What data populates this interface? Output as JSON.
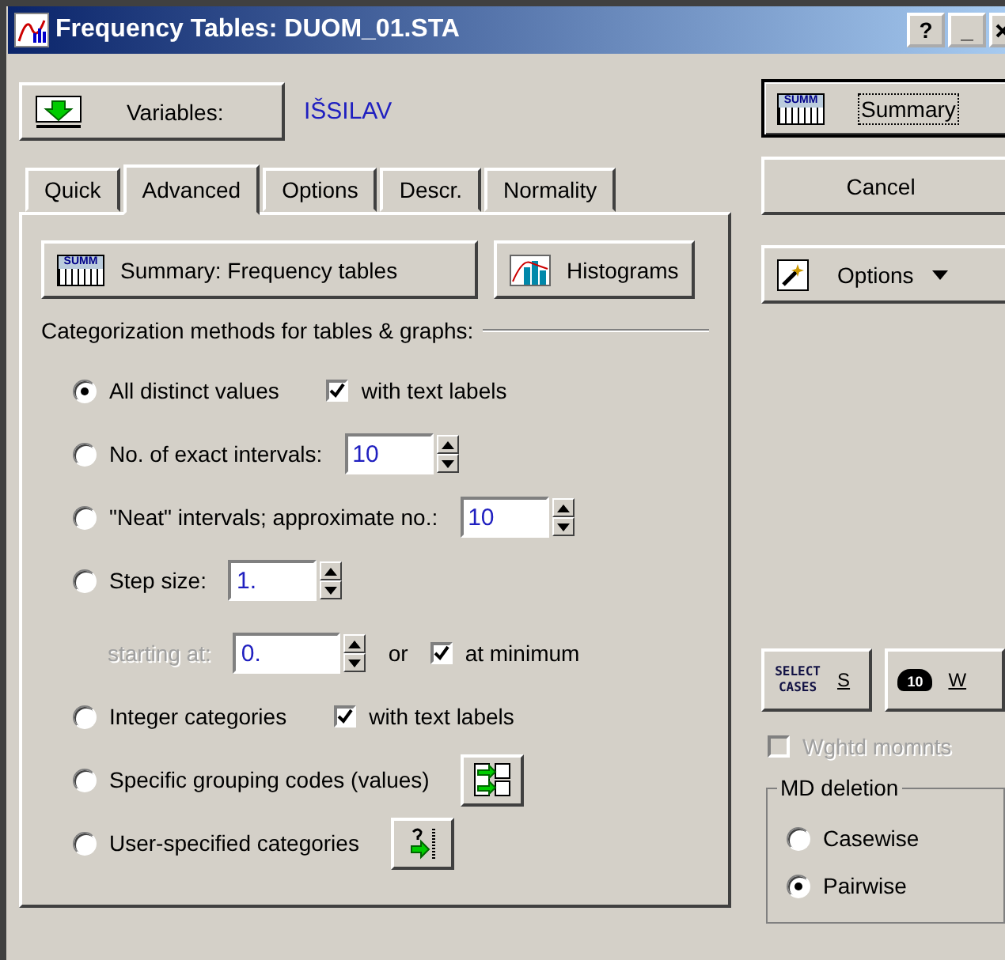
{
  "window": {
    "title": "Frequency Tables: DUOM_01.STA",
    "title_buttons": [
      "?",
      "_"
    ]
  },
  "variables": {
    "button": "Variables:",
    "value": "IŠSILAV"
  },
  "tabs": [
    {
      "label": "Quick",
      "selected": false
    },
    {
      "label": "Advanced",
      "selected": true
    },
    {
      "label": "Options",
      "selected": false
    },
    {
      "label": "Descr.",
      "selected": false
    },
    {
      "label": "Normality",
      "selected": false
    }
  ],
  "panel_buttons": [
    {
      "kind": "summary",
      "icon_text": "SUMM",
      "label": "Summary:  Frequency tables"
    },
    {
      "kind": "histogram",
      "label": "Histograms"
    }
  ],
  "section_heading": "Categorization methods for tables & graphs:",
  "methods": [
    {
      "kind": "checkbox",
      "label": "All distinct values",
      "selected": true,
      "check": {
        "label": "with text labels",
        "checked": true
      }
    },
    {
      "kind": "spin",
      "label": "No. of exact intervals:",
      "selected": false,
      "value": "10"
    },
    {
      "kind": "spin",
      "label": "\"Neat\" intervals; approximate no.:",
      "selected": false,
      "value": "10"
    },
    {
      "kind": "spin",
      "label": "Step size:",
      "selected": false,
      "value": "1."
    },
    {
      "kind": "start",
      "label": "starting at:",
      "disabled": true,
      "value": "0.",
      "joiner": "or",
      "check": {
        "label": "at minimum",
        "checked": true
      }
    },
    {
      "kind": "checkbox",
      "label": "Integer categories",
      "selected": false,
      "check": {
        "label": "with text labels",
        "checked": true
      }
    },
    {
      "kind": "codes",
      "label": "Specific grouping codes (values)",
      "selected": false
    },
    {
      "kind": "custom",
      "label": "User-specified categories",
      "selected": false
    }
  ],
  "side": {
    "summary": {
      "icon_text": "SUMM",
      "label": "Summary"
    },
    "cancel": "Cancel",
    "options": "Options",
    "select_cases": {
      "icon_text": "SELECT CASES",
      "shortcut": "S"
    },
    "weight": {
      "icon_text": "10",
      "shortcut": "W"
    },
    "weighted_moments": {
      "label": "Wghtd momnts",
      "checked": false,
      "disabled": true
    },
    "md_deletion": {
      "title": "MD deletion",
      "options": [
        {
          "label": "Casewise",
          "selected": false
        },
        {
          "label": "Pairwise",
          "selected": true
        }
      ]
    }
  }
}
